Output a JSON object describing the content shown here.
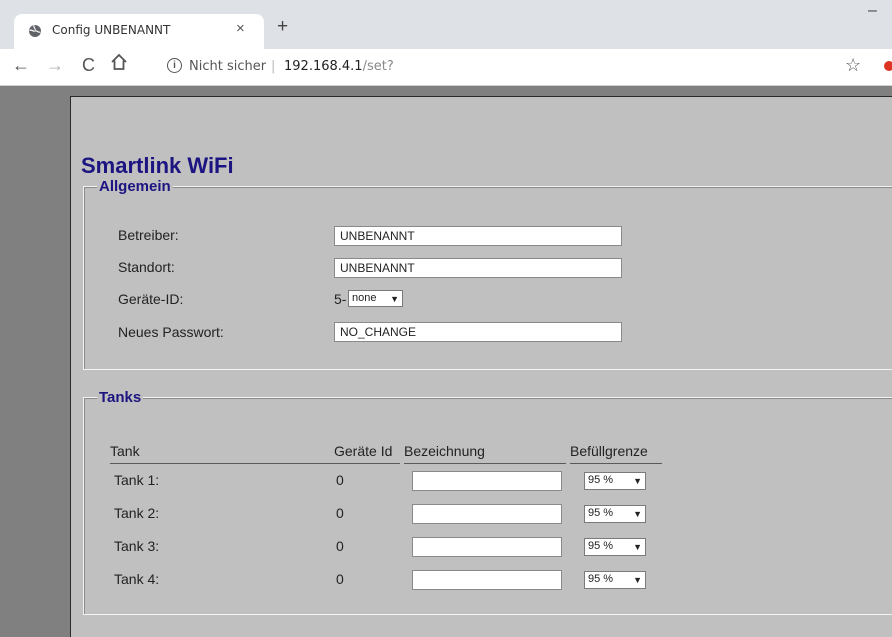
{
  "browser": {
    "tab_title": "Config UNBENANNT",
    "tab_close": "×",
    "new_tab": "+",
    "minimize": "–",
    "insecure_label": "Nicht sicher",
    "separator": "|",
    "url_host": "192.168.4.1",
    "url_path": "/set?"
  },
  "page": {
    "heading": "Smartlink WiFi",
    "general": {
      "legend": "Allgemein",
      "operator_label": "Betreiber:",
      "operator_value": "UNBENANNT",
      "location_label": "Standort:",
      "location_value": "UNBENANNT",
      "device_id_label": "Geräte-ID:",
      "device_id_prefix": "5-",
      "device_id_selected": "none",
      "password_label": "Neues Passwort:",
      "password_value": "NO_CHANGE"
    },
    "tanks": {
      "legend": "Tanks",
      "headers": {
        "tank": "Tank",
        "device_id": "Geräte Id",
        "name": "Bezeichnung",
        "fill_limit": "Befüllgrenze"
      },
      "rows": [
        {
          "label": "Tank 1:",
          "device_id": "0",
          "name": "",
          "fill_limit": "95 %"
        },
        {
          "label": "Tank 2:",
          "device_id": "0",
          "name": "",
          "fill_limit": "95 %"
        },
        {
          "label": "Tank 3:",
          "device_id": "0",
          "name": "",
          "fill_limit": "95 %"
        },
        {
          "label": "Tank 4:",
          "device_id": "0",
          "name": "",
          "fill_limit": "95 %"
        }
      ]
    }
  },
  "icons": {
    "favicon": "globe-icon",
    "back": "arrow-left-icon",
    "forward": "arrow-right-icon",
    "reload": "reload-icon",
    "home": "home-icon",
    "info": "info-icon",
    "bookmark": "star-icon"
  },
  "colors": {
    "heading": "#1c1480",
    "page_bg": "#c0c0c0",
    "outer_bg": "#808080"
  }
}
